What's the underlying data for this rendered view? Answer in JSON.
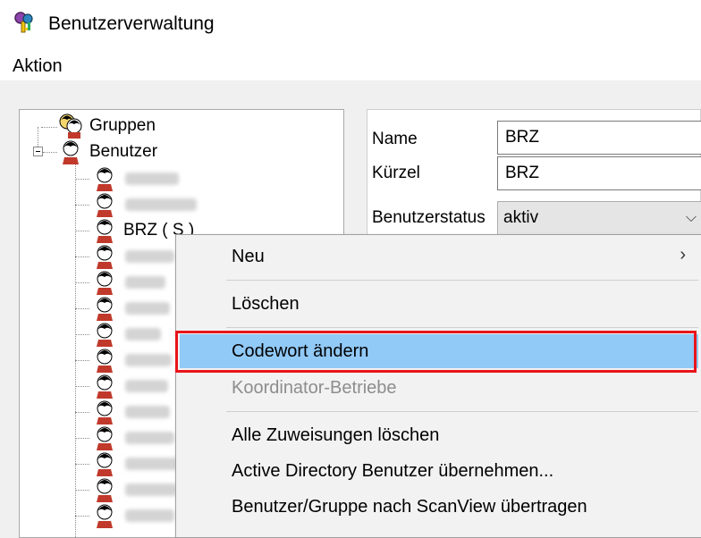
{
  "window": {
    "title": "Benutzerverwaltung",
    "icon": "keys-icon"
  },
  "menu": {
    "aktion": "Aktion"
  },
  "tree": {
    "groups_label": "Gruppen",
    "users_label": "Benutzer",
    "users": [
      {
        "label": "",
        "blurred": true
      },
      {
        "label": "",
        "blurred": true
      },
      {
        "label": "BRZ ( S )",
        "blurred": false
      },
      {
        "label": "",
        "blurred": true
      },
      {
        "label": "",
        "blurred": true
      },
      {
        "label": "",
        "blurred": true
      },
      {
        "label": "",
        "blurred": true
      },
      {
        "label": "",
        "blurred": true
      },
      {
        "label": "",
        "blurred": true
      },
      {
        "label": "",
        "blurred": true
      },
      {
        "label": "",
        "blurred": true
      },
      {
        "label": "",
        "blurred": true
      },
      {
        "label": "",
        "blurred": true
      },
      {
        "label": "",
        "blurred": true
      }
    ]
  },
  "form": {
    "name_label": "Name",
    "name_value": "BRZ",
    "kuerzel_label": "Kürzel",
    "kuerzel_value": "BRZ",
    "status_label": "Benutzerstatus",
    "status_value": "aktiv"
  },
  "context_menu": {
    "neu": "Neu",
    "loeschen": "Löschen",
    "codewort": "Codewort ändern",
    "koordinator": "Koordinator-Betriebe",
    "alle_zuweisungen": "Alle Zuweisungen löschen",
    "active_directory": "Active Directory Benutzer übernehmen...",
    "scanview": "Benutzer/Gruppe nach ScanView übertragen",
    "highlight_color": "#91c9f7",
    "annotation_color": "#e8151b"
  }
}
